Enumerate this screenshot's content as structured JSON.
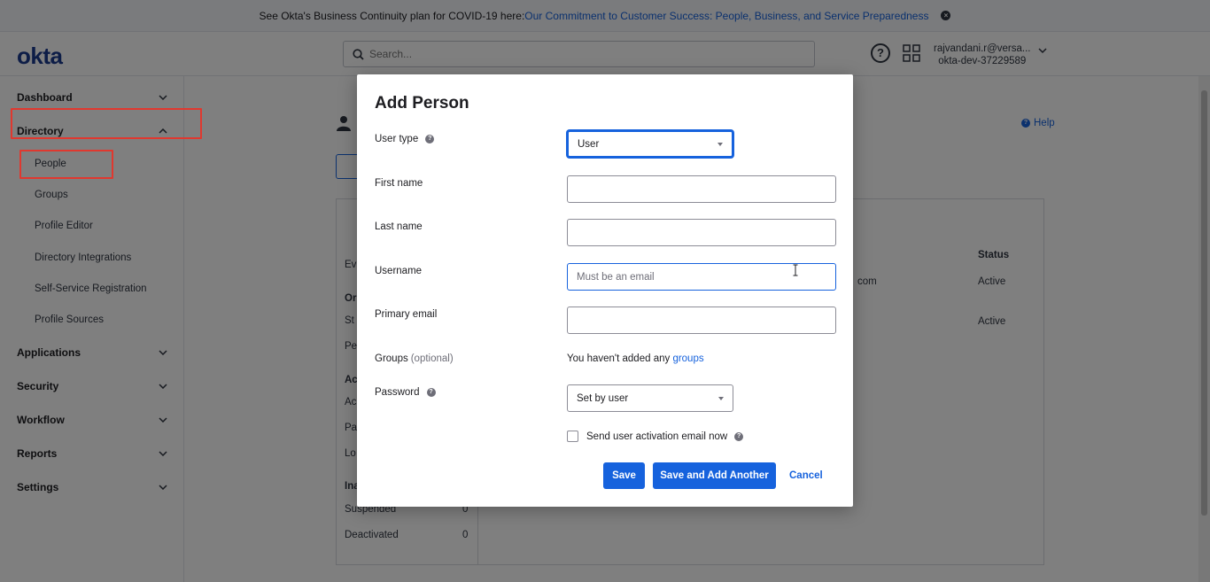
{
  "banner": {
    "text": "See Okta's Business Continuity plan for COVID-19 here: ",
    "link": "Our Commitment to Customer Success: People, Business, and Service Preparedness"
  },
  "header": {
    "logo": "okta",
    "search_placeholder": "Search...",
    "help_glyph": "?",
    "user_email": "rajvandani.r@versa...",
    "org": "okta-dev-37229589"
  },
  "sidebar": {
    "sections": [
      {
        "label": "Dashboard"
      },
      {
        "label": "Directory"
      },
      {
        "label": "Applications"
      },
      {
        "label": "Security"
      },
      {
        "label": "Workflow"
      },
      {
        "label": "Reports"
      },
      {
        "label": "Settings"
      }
    ],
    "directory_items": [
      {
        "label": "People"
      },
      {
        "label": "Groups"
      },
      {
        "label": "Profile Editor"
      },
      {
        "label": "Directory Integrations"
      },
      {
        "label": "Self-Service Registration"
      },
      {
        "label": "Profile Sources"
      }
    ]
  },
  "background": {
    "help_link": "Help",
    "status_header": "Status",
    "status_1": "Active",
    "status_2": "Active",
    "email_fragment": "com",
    "left_fragments": [
      "Ev",
      "Or",
      "St",
      "Pe",
      "Ac",
      "Ac",
      "Pa",
      "Lo",
      "Ina"
    ],
    "suspended_label": "Suspended",
    "suspended_count": "0",
    "deactivated_label": "Deactivated",
    "deactivated_count": "0"
  },
  "modal": {
    "title": "Add Person",
    "user_type_label": "User type",
    "user_type_value": "User",
    "first_name_label": "First name",
    "last_name_label": "Last name",
    "username_label": "Username",
    "username_placeholder": "Must be an email",
    "primary_email_label": "Primary email",
    "groups_label": "Groups",
    "groups_optional": "(optional)",
    "groups_text": "You haven't added any ",
    "groups_link": "groups",
    "password_label": "Password",
    "password_value": "Set by user",
    "activation_label": "Send user activation email now",
    "save": "Save",
    "save_add": "Save and Add Another",
    "cancel": "Cancel"
  },
  "colors": {
    "accent": "#1662dd",
    "highlight": "#e0382f"
  }
}
